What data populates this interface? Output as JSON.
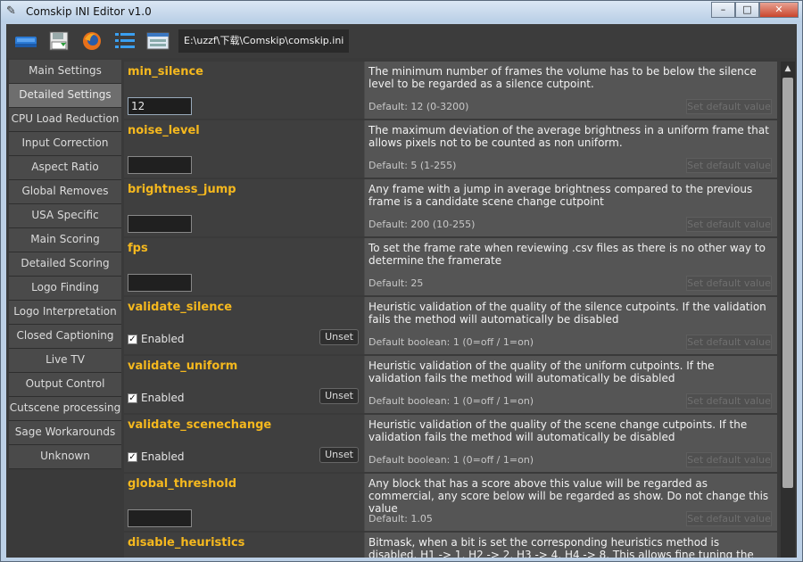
{
  "window": {
    "title": "Comskip INI Editor v1.0",
    "min": "–",
    "max": "□",
    "close": "✕"
  },
  "toolbar": {
    "icons": [
      "open-icon",
      "save-icon",
      "firefox-icon",
      "list-icon",
      "window-icon"
    ],
    "path": "E:\\uzzf\\下载\\Comskip\\comskip.ini"
  },
  "sidebar": {
    "items": [
      {
        "label": "Main Settings"
      },
      {
        "label": "Detailed Settings"
      },
      {
        "label": "CPU Load Reduction"
      },
      {
        "label": "Input Correction"
      },
      {
        "label": "Aspect Ratio"
      },
      {
        "label": "Global Removes"
      },
      {
        "label": "USA Specific"
      },
      {
        "label": "Main Scoring"
      },
      {
        "label": "Detailed Scoring"
      },
      {
        "label": "Logo Finding"
      },
      {
        "label": "Logo Interpretation"
      },
      {
        "label": "Closed Captioning"
      },
      {
        "label": "Live TV"
      },
      {
        "label": "Output Control"
      },
      {
        "label": "Cutscene processing"
      },
      {
        "label": "Sage Workarounds"
      },
      {
        "label": "Unknown"
      }
    ]
  },
  "params": {
    "common": {
      "set_default": "Set default value",
      "unset": "Unset",
      "enabled": "Enabled",
      "check": "✓"
    },
    "list": [
      {
        "name": "min_silence",
        "value": "12",
        "desc": "The minimum number of frames the volume has to be below the silence level to be regarded as a silence cutpoint.",
        "default": "Default: 12 (0-3200)"
      },
      {
        "name": "noise_level",
        "value": "",
        "desc": "The maximum deviation of the average brightness in a uniform frame that allows pixels not to be counted as non uniform.",
        "default": "Default: 5 (1-255)"
      },
      {
        "name": "brightness_jump",
        "value": "",
        "desc": "Any frame with a jump in average brightness compared to the previous frame is a candidate scene change cutpoint",
        "default": "Default: 200 (10-255)"
      },
      {
        "name": "fps",
        "value": "",
        "desc": "To set the frame rate when reviewing .csv files as there is no other way to determine the framerate",
        "default": "Default: 25"
      },
      {
        "name": "validate_silence",
        "desc": "Heuristic validation of the quality of the silence cutpoints. If the validation fails the method will automatically be disabled",
        "default": "Default boolean: 1 (0=off / 1=on)"
      },
      {
        "name": "validate_uniform",
        "desc": "Heuristic validation of the quality of the uniform cutpoints. If the validation fails the method will automatically be disabled",
        "default": "Default boolean: 1 (0=off / 1=on)"
      },
      {
        "name": "validate_scenechange",
        "desc": "Heuristic validation of the quality of the scene change cutpoints. If the validation fails the method will automatically be disabled",
        "default": "Default boolean: 1 (0=off / 1=on)"
      },
      {
        "name": "global_threshold",
        "value": "",
        "desc": "Any block that has a score above this value will be regarded as commercial, any score below will be regarded as show. Do not change this value",
        "default": "Default: 1.05"
      },
      {
        "name": "disable_heuristics",
        "desc": " Bitmask, when a bit is set the corresponding heuristics method is disabled. H1 -> 1, H2 -> 2, H3 -> 4, H4 -> 8. This allows fine tuning the methods that are used"
      }
    ]
  }
}
